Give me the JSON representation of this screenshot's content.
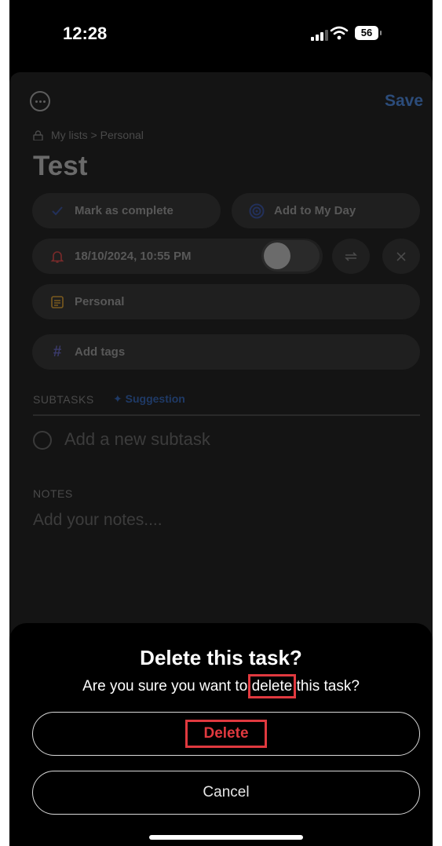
{
  "status_bar": {
    "time": "12:28",
    "battery": "56"
  },
  "header": {
    "save_label": "Save",
    "breadcrumb": "My lists > Personal",
    "task_title": "Test"
  },
  "actions": {
    "mark_complete": "Mark as complete",
    "add_to_my_day": "Add to My Day",
    "reminder": "18/10/2024, 10:55 PM",
    "list_name": "Personal",
    "add_tags": "Add tags"
  },
  "subtasks": {
    "label": "SUBTASKS",
    "suggestion": "Suggestion",
    "placeholder": "Add a new subtask"
  },
  "notes": {
    "label": "NOTES",
    "placeholder": "Add your notes...."
  },
  "dialog": {
    "title": "Delete this task?",
    "message_before": "Are you sure you want to ",
    "message_highlight": "delete",
    "message_after": " this task?",
    "delete_label": "Delete",
    "cancel_label": "Cancel"
  },
  "colors": {
    "accent": "#2c4c7a",
    "destructive": "#e0393f",
    "bell": "#7a2a2a",
    "list_icon": "#7a5a1e",
    "tags_icon": "#3a3a6a"
  }
}
